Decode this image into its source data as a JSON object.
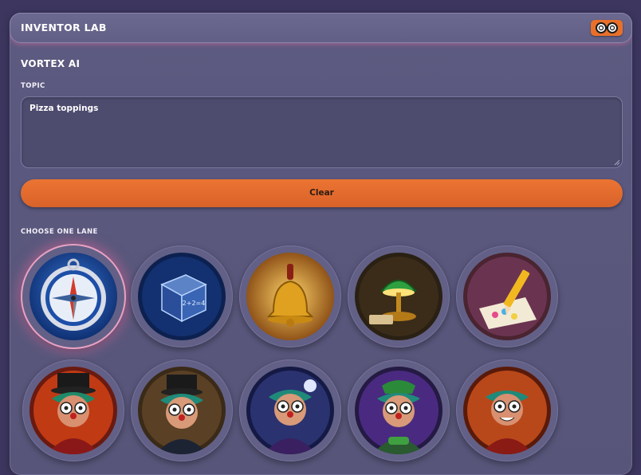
{
  "window": {
    "title": "INVENTOR LAB",
    "header_button_icon": "glasses-icon"
  },
  "app": {
    "name": "VORTEX AI"
  },
  "topic": {
    "label": "TOPIC",
    "value": "Pizza toppings"
  },
  "clear_button": {
    "label": "Clear"
  },
  "lanes": {
    "label": "CHOOSE ONE LANE",
    "items": [
      {
        "icon": "compass-icon",
        "selected": true
      },
      {
        "icon": "dice-cube-icon",
        "selected": false
      },
      {
        "icon": "bell-icon",
        "selected": false
      },
      {
        "icon": "desk-lamp-icon",
        "selected": false
      },
      {
        "icon": "pencil-sketch-icon",
        "selected": false
      }
    ]
  },
  "avatars": {
    "items": [
      {
        "icon": "ringmaster-avatar-icon"
      },
      {
        "icon": "professor-avatar-icon"
      },
      {
        "icon": "thinker-avatar-icon"
      },
      {
        "icon": "gamer-avatar-icon"
      },
      {
        "icon": "showman-avatar-icon"
      }
    ]
  },
  "colors": {
    "accent": "#e8702a",
    "panel": "#5c5a80",
    "selected_glow": "#ee6ea0"
  }
}
